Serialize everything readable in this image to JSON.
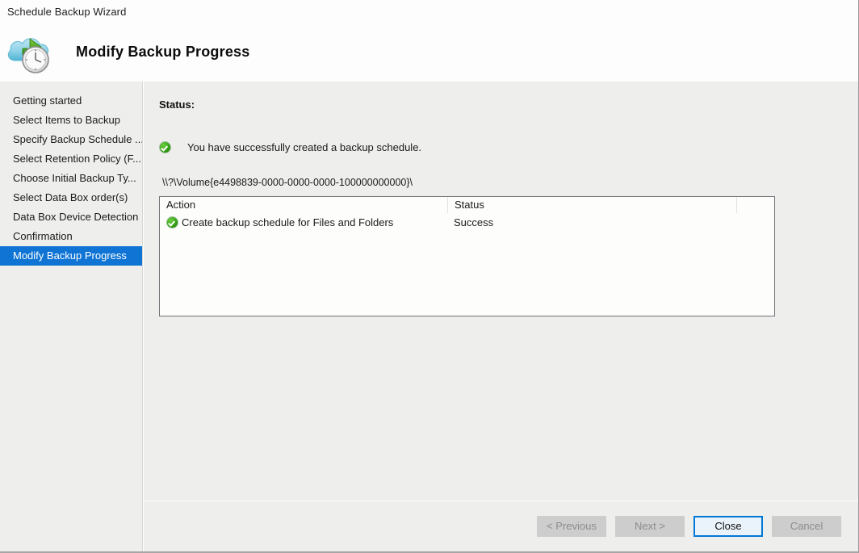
{
  "window": {
    "title": "Schedule Backup Wizard",
    "header_title": "Modify Backup Progress",
    "header_icon": "cloud-backup-clock-icon"
  },
  "sidebar": {
    "items": [
      {
        "label": "Getting started",
        "selected": false
      },
      {
        "label": "Select Items to Backup",
        "selected": false
      },
      {
        "label": "Specify Backup Schedule ...",
        "selected": false
      },
      {
        "label": "Select Retention Policy (F...",
        "selected": false
      },
      {
        "label": "Choose Initial Backup Ty...",
        "selected": false
      },
      {
        "label": "Select Data Box order(s)",
        "selected": false
      },
      {
        "label": "Data Box Device Detection",
        "selected": false
      },
      {
        "label": "Confirmation",
        "selected": false
      },
      {
        "label": "Modify Backup Progress",
        "selected": true
      }
    ]
  },
  "main": {
    "status_label": "Status:",
    "success_icon": "success-check-icon",
    "success_message": "You have successfully created a backup schedule.",
    "volume_path": "\\\\?\\Volume{e4498839-0000-0000-0000-100000000000}\\",
    "table": {
      "columns": [
        "Action",
        "Status",
        ""
      ],
      "rows": [
        {
          "icon": "success-check-icon",
          "action": "Create backup schedule for Files and Folders",
          "status": "Success"
        }
      ]
    }
  },
  "footer": {
    "buttons": [
      {
        "label": "< Previous",
        "enabled": false,
        "primary": false
      },
      {
        "label": "Next >",
        "enabled": false,
        "primary": false
      },
      {
        "label": "Close",
        "enabled": true,
        "primary": true
      },
      {
        "label": "Cancel",
        "enabled": false,
        "primary": false
      }
    ]
  },
  "colors": {
    "selection_blue": "#0f74d4",
    "focus_blue": "#0078d7",
    "success_green": "#35a314",
    "body_gray": "#eeeeec"
  }
}
